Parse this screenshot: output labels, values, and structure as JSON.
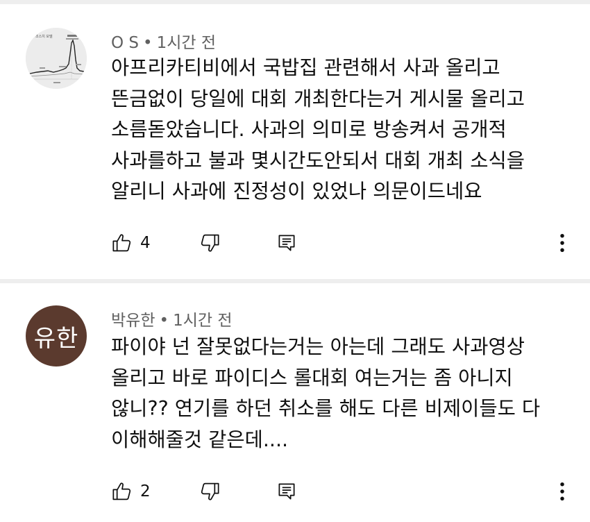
{
  "comments": [
    {
      "author": "O S",
      "separator": "•",
      "time": "1시간 전",
      "avatar_text": "",
      "avatar_chart_text": "조스치 모델",
      "lines": [
        "아프리카티비에서 국밥집 관련해서 사과 올리고",
        "뜬금없이 당일에 대회 개최한다는거 게시물 올리고",
        "소름돋았습니다. 사과의 의미로 방송켜서 공개적",
        "사과를하고 불과 몇시간도안되서 대회 개최 소식을",
        "알리니 사과에 진정성이 있었나 의문이드네요"
      ],
      "likes": "4",
      "icons": {
        "like": "thumb-up-icon",
        "dislike": "thumb-down-icon",
        "reply": "reply-icon",
        "more": "more-vert-icon"
      }
    },
    {
      "author": "박유한",
      "separator": "•",
      "time": "1시간 전",
      "avatar_text": "유한",
      "avatar_color": "#5b3a2e",
      "lines": [
        "파이야 넌 잘못없다는거는 아는데 그래도 사과영상",
        "올리고 바로 파이디스 롤대회 여는거는 좀 아니지",
        "않니?? 연기를 하던 취소를 해도 다른 비제이들도 다",
        "이해해줄것 같은데...."
      ],
      "likes": "2",
      "icons": {
        "like": "thumb-up-icon",
        "dislike": "thumb-down-icon",
        "reply": "reply-icon",
        "more": "more-vert-icon"
      }
    }
  ],
  "colors": {
    "meta_text": "#606060",
    "body_text": "#0f0f0f",
    "divider": "#eeeeee"
  }
}
